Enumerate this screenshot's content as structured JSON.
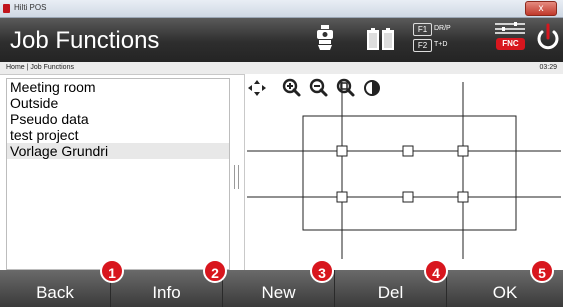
{
  "window": {
    "title": "Hilti POS",
    "close_label": "x"
  },
  "header": {
    "title": "Job Functions",
    "f1_key": "F1",
    "f1_label": "DR/P",
    "f2_key": "F2",
    "f2_label": "T+D",
    "fnc_label": "FNC",
    "icons": [
      "instrument-icon",
      "battery-icon",
      "battery-icon",
      "settings-icon",
      "power-icon"
    ]
  },
  "breadcrumb": {
    "path": "Home | Job Functions",
    "time": "03:29"
  },
  "job_list": {
    "items": [
      "Meeting room",
      "Outside",
      "Pseudo data",
      "test project",
      "Vorlage Grundri"
    ],
    "selected_index": 4
  },
  "map_toolbar": {
    "icons": [
      "pan-icon",
      "zoom-in-icon",
      "zoom-out-icon",
      "zoom-extents-icon",
      "contrast-icon"
    ]
  },
  "softkeys": [
    {
      "label": "Back",
      "badge": "1"
    },
    {
      "label": "Info",
      "badge": "2"
    },
    {
      "label": "New",
      "badge": "3"
    },
    {
      "label": "Del",
      "badge": "4"
    },
    {
      "label": "OK",
      "badge": "5"
    }
  ],
  "colors": {
    "accent": "#d8161e",
    "header": "#2e2e2e",
    "softkey": "#4d4d4d"
  }
}
